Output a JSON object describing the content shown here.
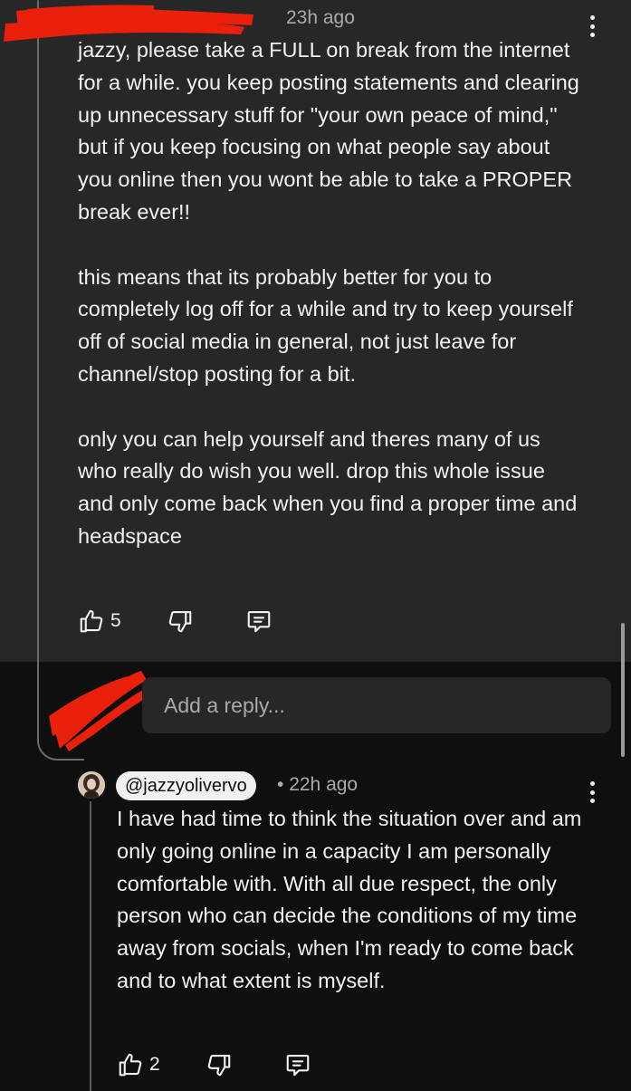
{
  "top_comment": {
    "timestamp": "23h ago",
    "paragraphs": [
      "jazzy, please take a FULL on break from the internet for a while. you keep posting statements and clearing up unnecessary stuff for \"your own peace of mind,\" but if you keep focusing on what people say about you online then you wont be able to take a PROPER break ever!!",
      "this means that its probably better for you to completely log off for a while and try to keep yourself off of social media in general, not just leave for channel/stop posting for a bit.",
      "only you can help yourself and theres many of us who really do wish you well. drop this whole issue and only come back when you find a proper time and headspace"
    ],
    "like_count": "5",
    "icons": [
      "thumbs-up-icon",
      "thumbs-down-icon",
      "comment-icon",
      "more-vert-icon"
    ]
  },
  "reply_input": {
    "placeholder": "Add a reply..."
  },
  "reply": {
    "handle": "@jazzyolivervo",
    "separator": "•",
    "timestamp": "22h ago",
    "text": "I have had time to think the situation over and am only going online in a capacity I am personally comfortable with. With all due respect, the only person who can decide the conditions of my time away from socials, when I'm ready to come back and to what extent is myself.",
    "like_count": "2"
  },
  "colors": {
    "page_bg": "#0f0f0f",
    "comment_bg": "#272727",
    "text": "#f1f1f1",
    "muted": "#aaaaaa",
    "redaction": "#e8200c"
  }
}
